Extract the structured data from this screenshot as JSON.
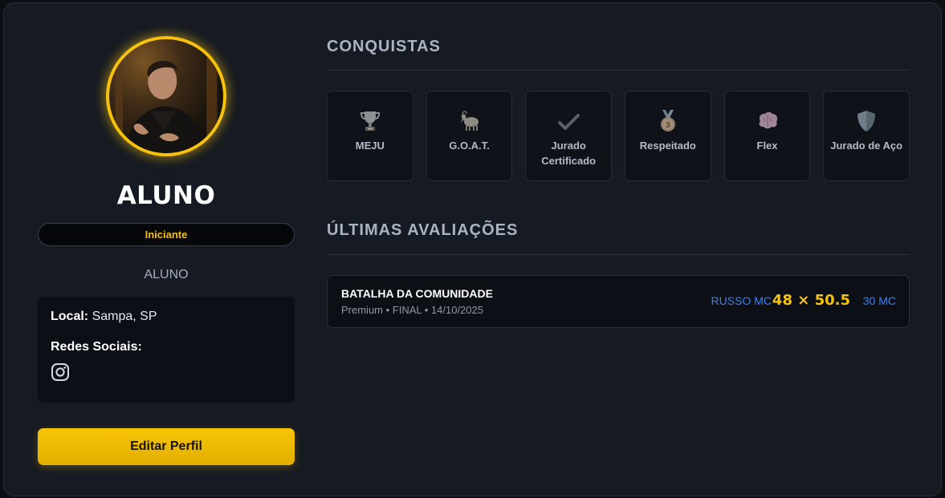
{
  "profile": {
    "name": "ALUNO",
    "level": "Iniciante",
    "role": "ALUNO",
    "local_label": "Local:",
    "local_value": "Sampa, SP",
    "socials_label": "Redes Sociais:",
    "socials": [
      "instagram-icon"
    ],
    "edit_button": "Editar Perfil"
  },
  "achievements": {
    "title": "CONQUISTAS",
    "items": [
      {
        "label": "MEJU",
        "icon": "trophy-icon"
      },
      {
        "label": "G.O.A.T.",
        "icon": "goat-icon"
      },
      {
        "label": "Jurado Certificado",
        "icon": "checkmark-icon"
      },
      {
        "label": "Respeitado",
        "icon": "medal-icon"
      },
      {
        "label": "Flex",
        "icon": "brain-icon"
      },
      {
        "label": "Jurado de Aço",
        "icon": "shield-icon"
      }
    ]
  },
  "evaluations": {
    "title": "ÚLTIMAS AVALIAÇÕES",
    "items": [
      {
        "event": "BATALHA DA COMUNIDADE",
        "details": "Premium • FINAL • 14/10/2025",
        "competitor_a": "RUSSO MC",
        "score": "48 × 50.5",
        "competitor_b": "30 MC"
      }
    ]
  },
  "colors": {
    "accent": "#f6c20f",
    "link_blue": "#3b82f6",
    "card_bg": "#161a22",
    "page_bg": "#0b0e13"
  }
}
